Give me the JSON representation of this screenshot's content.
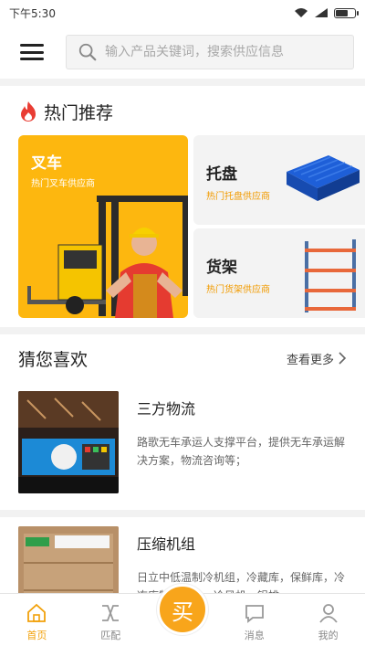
{
  "status_bar": {
    "time": "下午5:30",
    "battery_level": 0.7
  },
  "header": {
    "search_placeholder": "输入产品关键词，搜索供应信息"
  },
  "hot": {
    "title": "热门推荐",
    "cards": [
      {
        "title": "叉车",
        "subtitle": "热门叉车供应商"
      },
      {
        "title": "托盘",
        "subtitle": "热门托盘供应商"
      },
      {
        "title": "货架",
        "subtitle": "热门货架供应商"
      }
    ]
  },
  "guess": {
    "title": "猜您喜欢",
    "more_label": "查看更多",
    "items": [
      {
        "title": "三方物流",
        "desc": "路歌无车承运人支撑平台，提供无车承运解决方案，物流咨询等；"
      },
      {
        "title": "压缩机组",
        "desc": "日立中低温制冷机组，冷藏库，保鲜库，冷冻库制冷机组，冷风机，铝排"
      }
    ]
  },
  "nav": {
    "home": "首页",
    "match": "匹配",
    "buy": "买",
    "messages": "消息",
    "mine": "我的"
  },
  "colors": {
    "accent": "#f8a51b",
    "forklift_card": "#fdb70f",
    "subtitle_orange": "#f29b00"
  }
}
